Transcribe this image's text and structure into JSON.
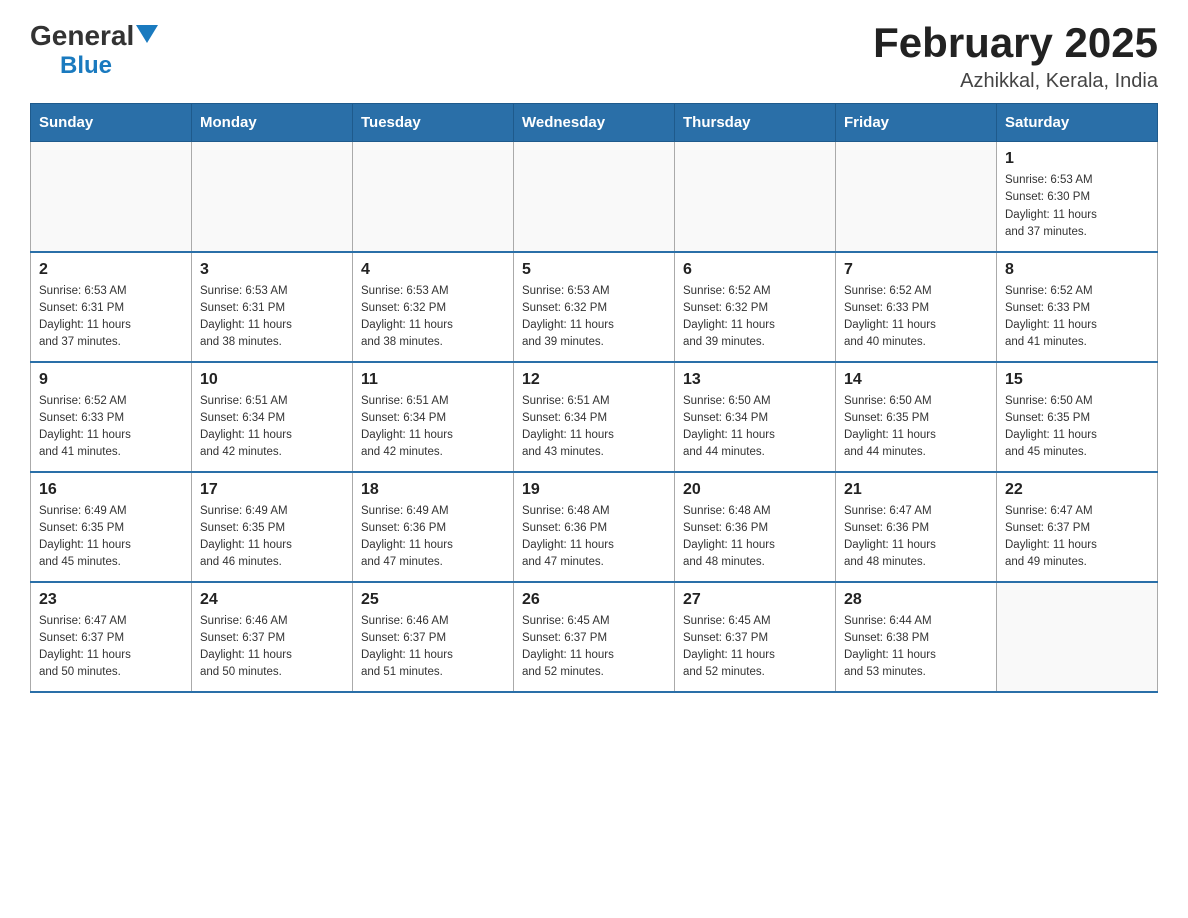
{
  "header": {
    "logo_general": "General",
    "logo_blue": "Blue",
    "title": "February 2025",
    "subtitle": "Azhikkal, Kerala, India"
  },
  "calendar": {
    "headers": [
      "Sunday",
      "Monday",
      "Tuesday",
      "Wednesday",
      "Thursday",
      "Friday",
      "Saturday"
    ],
    "weeks": [
      [
        {
          "day": "",
          "info": ""
        },
        {
          "day": "",
          "info": ""
        },
        {
          "day": "",
          "info": ""
        },
        {
          "day": "",
          "info": ""
        },
        {
          "day": "",
          "info": ""
        },
        {
          "day": "",
          "info": ""
        },
        {
          "day": "1",
          "info": "Sunrise: 6:53 AM\nSunset: 6:30 PM\nDaylight: 11 hours\nand 37 minutes."
        }
      ],
      [
        {
          "day": "2",
          "info": "Sunrise: 6:53 AM\nSunset: 6:31 PM\nDaylight: 11 hours\nand 37 minutes."
        },
        {
          "day": "3",
          "info": "Sunrise: 6:53 AM\nSunset: 6:31 PM\nDaylight: 11 hours\nand 38 minutes."
        },
        {
          "day": "4",
          "info": "Sunrise: 6:53 AM\nSunset: 6:32 PM\nDaylight: 11 hours\nand 38 minutes."
        },
        {
          "day": "5",
          "info": "Sunrise: 6:53 AM\nSunset: 6:32 PM\nDaylight: 11 hours\nand 39 minutes."
        },
        {
          "day": "6",
          "info": "Sunrise: 6:52 AM\nSunset: 6:32 PM\nDaylight: 11 hours\nand 39 minutes."
        },
        {
          "day": "7",
          "info": "Sunrise: 6:52 AM\nSunset: 6:33 PM\nDaylight: 11 hours\nand 40 minutes."
        },
        {
          "day": "8",
          "info": "Sunrise: 6:52 AM\nSunset: 6:33 PM\nDaylight: 11 hours\nand 41 minutes."
        }
      ],
      [
        {
          "day": "9",
          "info": "Sunrise: 6:52 AM\nSunset: 6:33 PM\nDaylight: 11 hours\nand 41 minutes."
        },
        {
          "day": "10",
          "info": "Sunrise: 6:51 AM\nSunset: 6:34 PM\nDaylight: 11 hours\nand 42 minutes."
        },
        {
          "day": "11",
          "info": "Sunrise: 6:51 AM\nSunset: 6:34 PM\nDaylight: 11 hours\nand 42 minutes."
        },
        {
          "day": "12",
          "info": "Sunrise: 6:51 AM\nSunset: 6:34 PM\nDaylight: 11 hours\nand 43 minutes."
        },
        {
          "day": "13",
          "info": "Sunrise: 6:50 AM\nSunset: 6:34 PM\nDaylight: 11 hours\nand 44 minutes."
        },
        {
          "day": "14",
          "info": "Sunrise: 6:50 AM\nSunset: 6:35 PM\nDaylight: 11 hours\nand 44 minutes."
        },
        {
          "day": "15",
          "info": "Sunrise: 6:50 AM\nSunset: 6:35 PM\nDaylight: 11 hours\nand 45 minutes."
        }
      ],
      [
        {
          "day": "16",
          "info": "Sunrise: 6:49 AM\nSunset: 6:35 PM\nDaylight: 11 hours\nand 45 minutes."
        },
        {
          "day": "17",
          "info": "Sunrise: 6:49 AM\nSunset: 6:35 PM\nDaylight: 11 hours\nand 46 minutes."
        },
        {
          "day": "18",
          "info": "Sunrise: 6:49 AM\nSunset: 6:36 PM\nDaylight: 11 hours\nand 47 minutes."
        },
        {
          "day": "19",
          "info": "Sunrise: 6:48 AM\nSunset: 6:36 PM\nDaylight: 11 hours\nand 47 minutes."
        },
        {
          "day": "20",
          "info": "Sunrise: 6:48 AM\nSunset: 6:36 PM\nDaylight: 11 hours\nand 48 minutes."
        },
        {
          "day": "21",
          "info": "Sunrise: 6:47 AM\nSunset: 6:36 PM\nDaylight: 11 hours\nand 48 minutes."
        },
        {
          "day": "22",
          "info": "Sunrise: 6:47 AM\nSunset: 6:37 PM\nDaylight: 11 hours\nand 49 minutes."
        }
      ],
      [
        {
          "day": "23",
          "info": "Sunrise: 6:47 AM\nSunset: 6:37 PM\nDaylight: 11 hours\nand 50 minutes."
        },
        {
          "day": "24",
          "info": "Sunrise: 6:46 AM\nSunset: 6:37 PM\nDaylight: 11 hours\nand 50 minutes."
        },
        {
          "day": "25",
          "info": "Sunrise: 6:46 AM\nSunset: 6:37 PM\nDaylight: 11 hours\nand 51 minutes."
        },
        {
          "day": "26",
          "info": "Sunrise: 6:45 AM\nSunset: 6:37 PM\nDaylight: 11 hours\nand 52 minutes."
        },
        {
          "day": "27",
          "info": "Sunrise: 6:45 AM\nSunset: 6:37 PM\nDaylight: 11 hours\nand 52 minutes."
        },
        {
          "day": "28",
          "info": "Sunrise: 6:44 AM\nSunset: 6:38 PM\nDaylight: 11 hours\nand 53 minutes."
        },
        {
          "day": "",
          "info": ""
        }
      ]
    ]
  }
}
